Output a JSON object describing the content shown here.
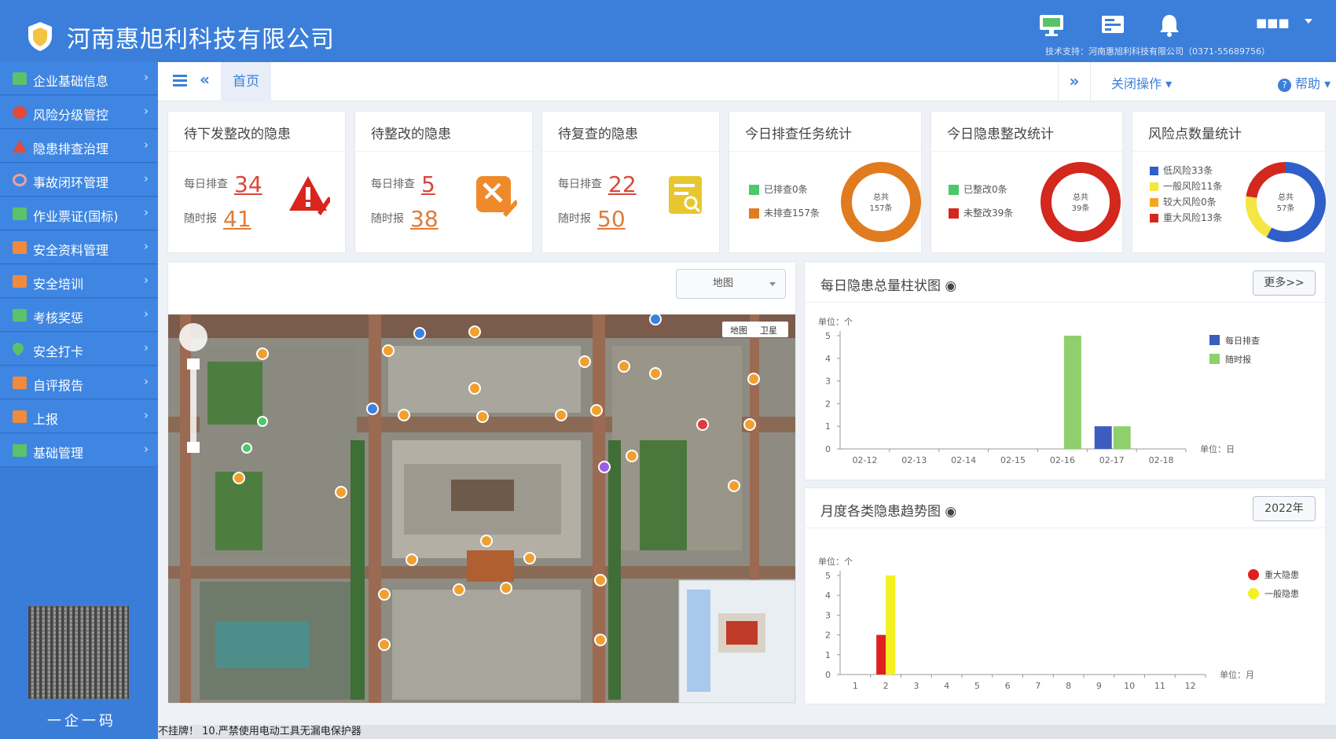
{
  "header": {
    "company": "河南惠旭利科技有限公司",
    "user": "■■■",
    "support": "技术支持：河南惠旭利科技有限公司（0371-55689756）"
  },
  "sidebar": {
    "items": [
      {
        "label": "企业基础信息",
        "icon": "building-icon",
        "color": "#5cc26a"
      },
      {
        "label": "风险分级管控",
        "icon": "shield-risk-icon",
        "color": "#e34a3a"
      },
      {
        "label": "隐患排查治理",
        "icon": "warning-icon",
        "color": "#e34a3a"
      },
      {
        "label": "事故闭环管理",
        "icon": "cycle-icon",
        "color": "#f0a0a0"
      },
      {
        "label": "作业票证(国标)",
        "icon": "ticket-icon",
        "color": "#5cc26a"
      },
      {
        "label": "安全资料管理",
        "icon": "folder-icon",
        "color": "#f08a3c"
      },
      {
        "label": "安全培训",
        "icon": "training-icon",
        "color": "#f08a3c"
      },
      {
        "label": "考核奖惩",
        "icon": "award-icon",
        "color": "#5cc26a"
      },
      {
        "label": "安全打卡",
        "icon": "location-pin-icon",
        "color": "#5cc26a"
      },
      {
        "label": "自评报告",
        "icon": "report-icon",
        "color": "#f08a3c"
      },
      {
        "label": "上报",
        "icon": "upload-icon",
        "color": "#f08a3c"
      },
      {
        "label": "基础管理",
        "icon": "settings-grid-icon",
        "color": "#5cc26a"
      }
    ],
    "qr_caption": "一企一码"
  },
  "toolbar": {
    "tab_home": "首页",
    "close_ops": "关闭操作",
    "help": "帮助"
  },
  "cards": {
    "c1": {
      "title": "待下发整改的隐患",
      "daily_label": "每日排查",
      "daily": "34",
      "random_label": "随时报",
      "random": "41"
    },
    "c2": {
      "title": "待整改的隐患",
      "daily_label": "每日排查",
      "daily": "5",
      "random_label": "随时报",
      "random": "38"
    },
    "c3": {
      "title": "待复查的隐患",
      "daily_label": "每日排查",
      "daily": "22",
      "random_label": "随时报",
      "random": "50"
    },
    "c4": {
      "title": "今日排查任务统计",
      "done": "已排查0条",
      "todo": "未排查157条",
      "center1": "总共",
      "center2": "157条",
      "done_count": 0,
      "todo_count": 157,
      "colors": [
        "#4cc86a",
        "#e07b20"
      ]
    },
    "c5": {
      "title": "今日隐患整改统计",
      "done": "已整改0条",
      "todo": "未整改39条",
      "center1": "总共",
      "center2": "39条",
      "done_count": 0,
      "todo_count": 39,
      "colors": [
        "#4cc86a",
        "#d2281e"
      ]
    },
    "c6": {
      "title": "风险点数量统计",
      "l1": "低风险33条",
      "l2": "一般风险11条",
      "l3": "较大风险0条",
      "l4": "重大风险13条",
      "center1": "总共",
      "center2": "57条",
      "counts": [
        33,
        11,
        0,
        13
      ],
      "colors": [
        "#2f5fc9",
        "#f5e642",
        "#f5a623",
        "#d2281e"
      ]
    }
  },
  "map": {
    "type_select": "地图",
    "map_btn": "地图",
    "sat_btn": "卫星"
  },
  "chart1": {
    "title": "每日隐患总量柱状图",
    "more": "更多>>",
    "unit_y": "单位：个",
    "unit_x": "单位：日"
  },
  "chart2": {
    "title": "月度各类隐患趋势图",
    "year": "2022年",
    "unit_y": "单位：个",
    "unit_x": "单位：月"
  },
  "ticker": "不挂牌！ 10.严禁使用电动工具无漏电保护器",
  "chart_data": [
    {
      "type": "bar",
      "title": "每日隐患总量柱状图",
      "categories": [
        "02-12",
        "02-13",
        "02-14",
        "02-15",
        "02-16",
        "02-17",
        "02-18"
      ],
      "series": [
        {
          "name": "每日排查",
          "color": "#3d5cbf",
          "values": [
            0,
            0,
            0,
            0,
            0,
            1,
            0
          ]
        },
        {
          "name": "随时报",
          "color": "#8fcf6e",
          "values": [
            0,
            0,
            0,
            0,
            5,
            1,
            0
          ]
        }
      ],
      "ylim": [
        0,
        5
      ],
      "yticks": [
        0,
        1,
        2,
        3,
        4,
        5
      ],
      "ylabel": "单位：个",
      "xlabel": "单位：日"
    },
    {
      "type": "bar",
      "title": "月度各类隐患趋势图",
      "categories": [
        "1",
        "2",
        "3",
        "4",
        "5",
        "6",
        "7",
        "8",
        "9",
        "10",
        "11",
        "12"
      ],
      "series": [
        {
          "name": "重大隐患",
          "color": "#e02020",
          "values": [
            0,
            2,
            0,
            0,
            0,
            0,
            0,
            0,
            0,
            0,
            0,
            0
          ]
        },
        {
          "name": "一般隐患",
          "color": "#f5f020",
          "values": [
            0,
            5,
            0,
            0,
            0,
            0,
            0,
            0,
            0,
            0,
            0,
            0
          ]
        }
      ],
      "ylim": [
        0,
        5
      ],
      "yticks": [
        0,
        1,
        2,
        3,
        4,
        5
      ],
      "ylabel": "单位：个",
      "xlabel": "单位：月"
    }
  ]
}
